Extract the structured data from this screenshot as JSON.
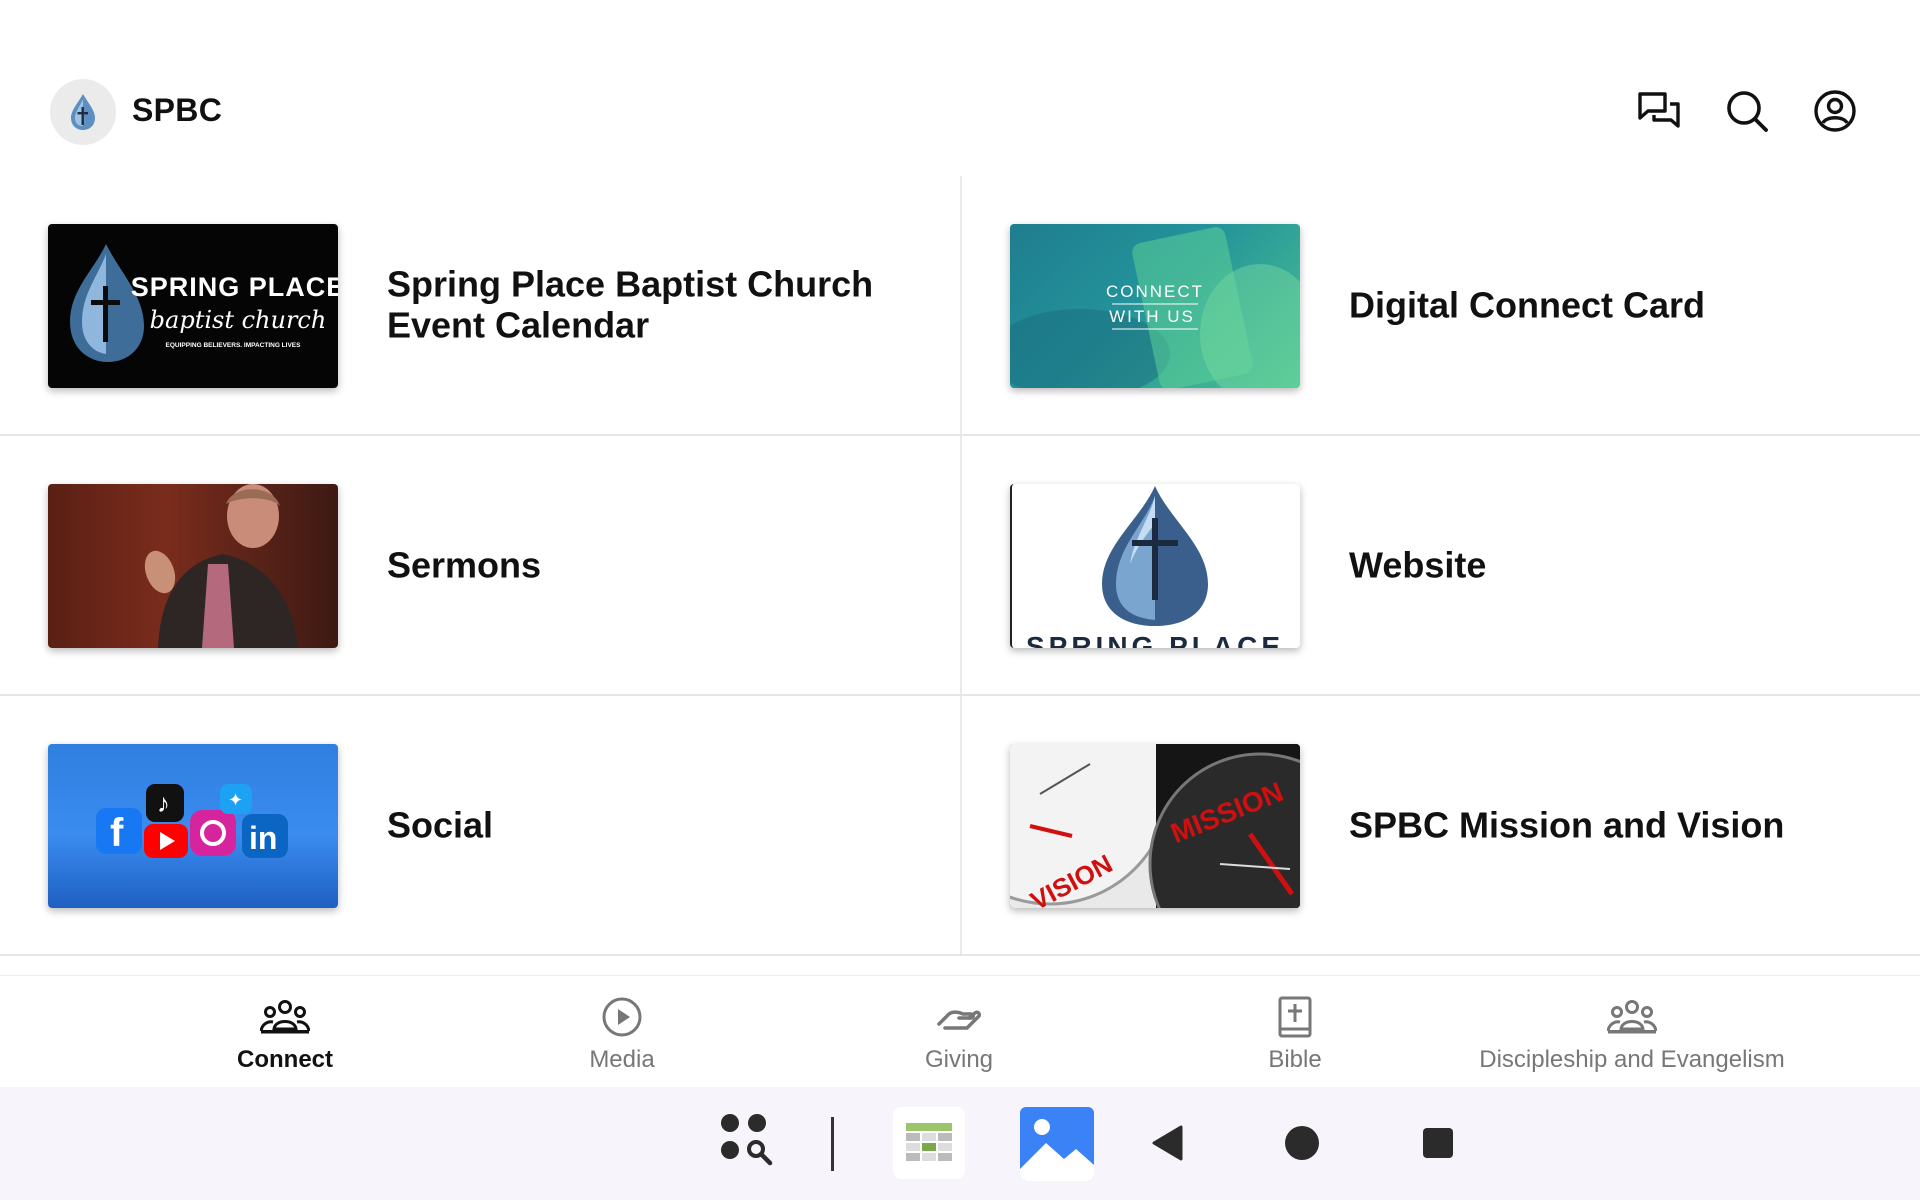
{
  "header": {
    "title": "SPBC",
    "icons": [
      "chat-icon",
      "search-icon",
      "account-icon"
    ]
  },
  "tiles": [
    {
      "title": "Spring Place Baptist Church Event Calendar",
      "thumb_text": "SPRING PLACE",
      "thumb_script": "baptist church",
      "thumb_tagline": "EQUIPPING BELIEVERS. IMPACTING LIVES"
    },
    {
      "title": "Digital Connect Card",
      "thumb_line1": "CONNECT",
      "thumb_line2": "WITH US"
    },
    {
      "title": "Sermons"
    },
    {
      "title": "Website",
      "thumb_text": "SPRING PLACE"
    },
    {
      "title": "Social"
    },
    {
      "title": "SPBC Mission and Vision",
      "thumb_left": "VISION",
      "thumb_right": "MISSION"
    }
  ],
  "nav": {
    "items": [
      {
        "label": "Connect",
        "icon": "group-icon",
        "active": true
      },
      {
        "label": "Media",
        "icon": "play-icon",
        "active": false
      },
      {
        "label": "Giving",
        "icon": "giving-hand-icon",
        "active": false
      },
      {
        "label": "Bible",
        "icon": "bible-icon",
        "active": false
      },
      {
        "label": "Discipleship and Evangelism",
        "icon": "group-icon",
        "active": false
      }
    ]
  },
  "colors": {
    "text": "#111111",
    "inactive": "#777777",
    "divider": "#e6e6e6",
    "brand_blue": "#3f6d9a",
    "system_bar": "#f7f5fb"
  }
}
